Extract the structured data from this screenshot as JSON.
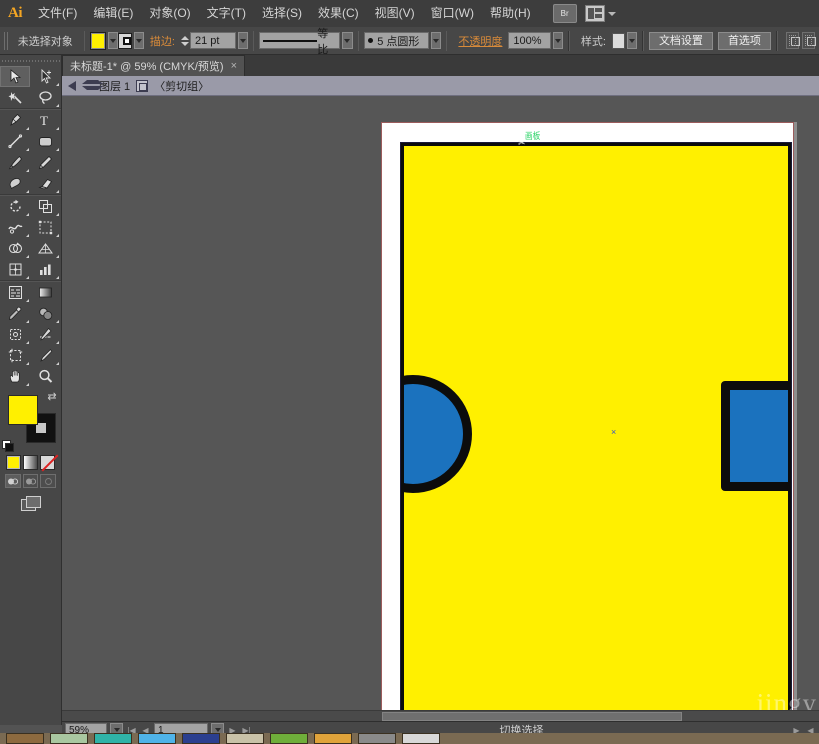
{
  "app": {
    "logo": "Ai"
  },
  "menubar": {
    "items": [
      {
        "label": "文件(F)"
      },
      {
        "label": "编辑(E)"
      },
      {
        "label": "对象(O)"
      },
      {
        "label": "文字(T)"
      },
      {
        "label": "选择(S)"
      },
      {
        "label": "效果(C)"
      },
      {
        "label": "视图(V)"
      },
      {
        "label": "窗口(W)"
      },
      {
        "label": "帮助(H)"
      }
    ],
    "bridge_label": "Br"
  },
  "controlbar": {
    "selection_status": "未选择对象",
    "stroke_label": "描边:",
    "stroke_weight": "21 pt",
    "profile_label": "等比",
    "brush_label": "5 点圆形",
    "opacity_label": "不透明度",
    "opacity_value": "100%",
    "style_label": "样式:",
    "document_setup": "文档设置",
    "preferences": "首选项"
  },
  "tabbar": {
    "tab_title": "未标题-1* @ 59% (CMYK/预览)",
    "close_glyph": "×"
  },
  "breadcrumb": {
    "layer": "图层 1",
    "group": "〈剪切组〉"
  },
  "toolbox": {
    "tools": [
      {
        "name": "selection-tool",
        "selected": true
      },
      {
        "name": "direct-selection-tool",
        "selected": false
      },
      {
        "name": "magic-wand-tool",
        "selected": false
      },
      {
        "name": "lasso-tool",
        "selected": false
      },
      {
        "name": "pen-tool",
        "selected": false
      },
      {
        "name": "type-tool",
        "selected": false
      },
      {
        "name": "line-segment-tool",
        "selected": false
      },
      {
        "name": "rectangle-tool",
        "selected": false
      },
      {
        "name": "paintbrush-tool",
        "selected": false
      },
      {
        "name": "pencil-tool",
        "selected": false
      },
      {
        "name": "blob-brush-tool",
        "selected": false
      },
      {
        "name": "eraser-tool",
        "selected": false
      },
      {
        "name": "rotate-tool",
        "selected": false
      },
      {
        "name": "scale-tool",
        "selected": false
      },
      {
        "name": "warp-tool",
        "selected": false
      },
      {
        "name": "free-transform-tool",
        "selected": false
      },
      {
        "name": "shape-builder-tool",
        "selected": false
      },
      {
        "name": "perspective-grid-tool",
        "selected": false
      },
      {
        "name": "mesh-tool",
        "selected": false
      },
      {
        "name": "gradient-tool",
        "selected": false
      },
      {
        "name": "eyedropper-tool",
        "selected": false
      },
      {
        "name": "blend-tool",
        "selected": false
      },
      {
        "name": "symbol-sprayer-tool",
        "selected": false
      },
      {
        "name": "column-graph-tool",
        "selected": false
      },
      {
        "name": "artboard-tool",
        "selected": false
      },
      {
        "name": "slice-tool",
        "selected": false
      },
      {
        "name": "hand-tool",
        "selected": false
      },
      {
        "name": "zoom-tool",
        "selected": false
      }
    ],
    "fill_color": "#FFF000",
    "stroke_color": "#111111"
  },
  "canvas": {
    "artboard_label": "画板",
    "cursor_glyph": "✂",
    "center_glyph": "×",
    "artboard_fill": "#FFF000",
    "shape_fill": "#1B72BE",
    "shape_stroke": "#0C0C0C",
    "watermark": "jingy"
  },
  "statusbar": {
    "zoom": "59%",
    "page": "1",
    "status_text": "切换选择"
  }
}
